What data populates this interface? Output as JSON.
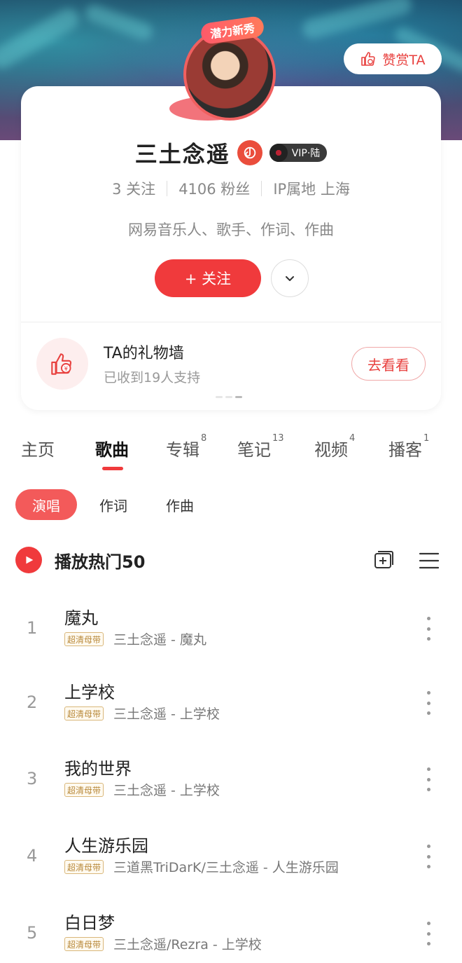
{
  "header": {
    "praise_label": "赞赏TA",
    "avatar_badge": "潜力新秀"
  },
  "profile": {
    "name": "三土念遥",
    "vip_label": "VIP·陆",
    "stats": {
      "following": "3 关注",
      "fans": "4106 粉丝",
      "ip": "IP属地 上海"
    },
    "description": "网易音乐人、歌手、作词、作曲",
    "follow_label": "+ 关注"
  },
  "gift_wall": {
    "title": "TA的礼物墙",
    "subtitle": "已收到19人支持",
    "button": "去看看"
  },
  "tabs": [
    {
      "label": "主页",
      "count": ""
    },
    {
      "label": "歌曲",
      "count": ""
    },
    {
      "label": "专辑",
      "count": "8"
    },
    {
      "label": "笔记",
      "count": "13"
    },
    {
      "label": "视频",
      "count": "4"
    },
    {
      "label": "播客",
      "count": "1"
    }
  ],
  "active_tab": "歌曲",
  "subtabs": [
    "演唱",
    "作词",
    "作曲"
  ],
  "active_subtab": "演唱",
  "playlist": {
    "title": "播放热门50"
  },
  "songs": [
    {
      "index": "1",
      "title": "魔丸",
      "tag": "超清母带",
      "meta": "三土念遥 - 魔丸"
    },
    {
      "index": "2",
      "title": "上学校",
      "tag": "超清母带",
      "meta": "三土念遥 - 上学校"
    },
    {
      "index": "3",
      "title": "我的世界",
      "tag": "超清母带",
      "meta": "三土念遥 - 上学校"
    },
    {
      "index": "4",
      "title": "人生游乐园",
      "tag": "超清母带",
      "meta": "三道黑TriDarK/三土念遥 - 人生游乐园"
    },
    {
      "index": "5",
      "title": "白日梦",
      "tag": "超清母带",
      "meta": "三土念遥/Rezra - 上学校"
    }
  ],
  "colors": {
    "accent": "#f03a3c",
    "tag_gold": "#b8893a"
  }
}
